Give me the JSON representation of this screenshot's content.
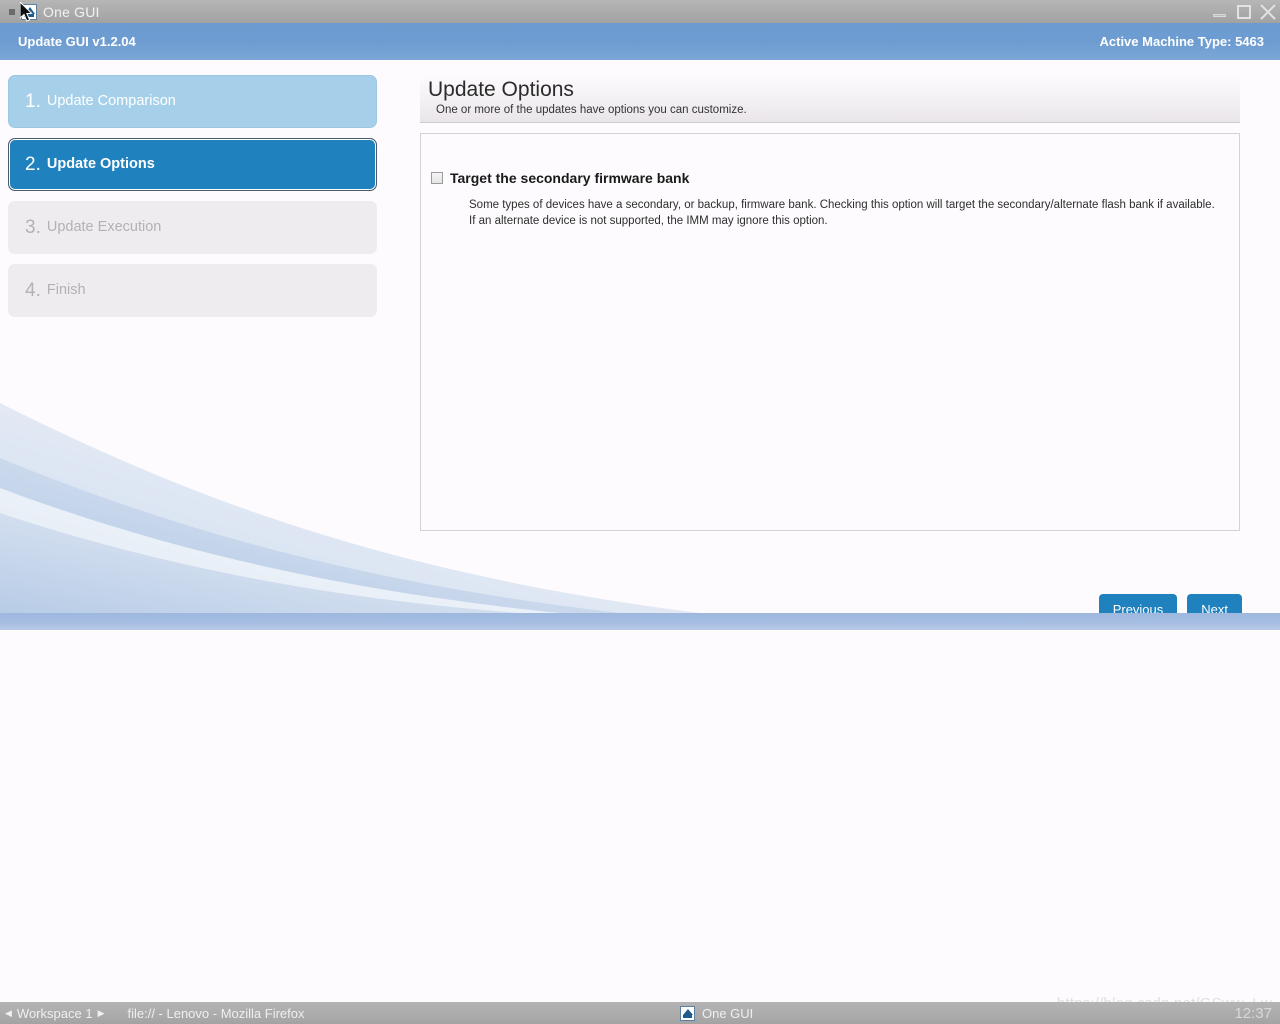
{
  "window": {
    "title": "One GUI",
    "icon": "app-icon",
    "controls": {
      "minimize": "minimize",
      "maximize": "maximize",
      "close": "close"
    }
  },
  "app_header": {
    "version_label": "Update GUI v1.2.04",
    "machine_label": "Active Machine Type: 5463"
  },
  "sidebar": {
    "steps": [
      {
        "num": "1.",
        "label": "Update Comparison",
        "state": "done"
      },
      {
        "num": "2.",
        "label": "Update Options",
        "state": "active"
      },
      {
        "num": "3.",
        "label": "Update Execution",
        "state": "pending"
      },
      {
        "num": "4.",
        "label": "Finish",
        "state": "pending"
      }
    ]
  },
  "content": {
    "title": "Update Options",
    "subtitle": "One or more of the updates have options you can customize.",
    "options": [
      {
        "label": "Target the secondary firmware bank",
        "checked": false,
        "description": "Some types of devices have a secondary, or backup, firmware bank. Checking this option will target the secondary/alternate flash bank if available. If an alternate device is not supported, the IMM may ignore this option."
      }
    ]
  },
  "buttons": {
    "previous": "Previous",
    "next": "Next"
  },
  "taskbar": {
    "prev_arrow": "◀",
    "next_arrow": "▶",
    "workspace": "Workspace 1",
    "windows": [
      {
        "title": "file:// - Lenovo - Mozilla Firefox"
      },
      {
        "title": "One GUI"
      }
    ],
    "clock": "12:37"
  },
  "watermark": "https://blog.csdn.net/GSww_Lw",
  "colors": {
    "accent": "#1f81bd",
    "header_blue": "#6d9cd1",
    "step_done": "#a6d0ea",
    "step_pending": "#efecef",
    "titlebar_gray": "#ababab"
  }
}
